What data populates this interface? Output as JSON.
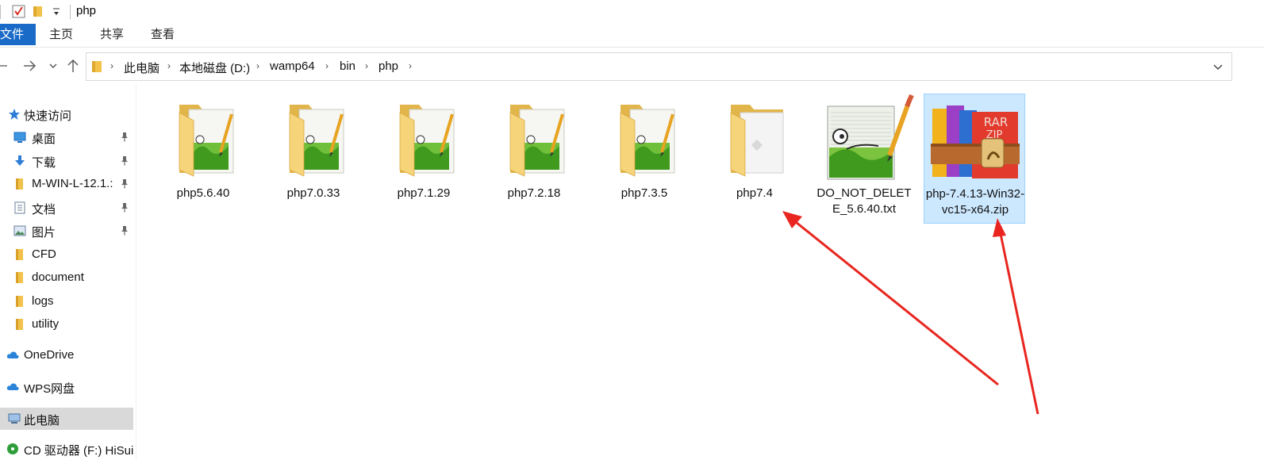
{
  "window": {
    "title": "php"
  },
  "ribbon": {
    "tabs": [
      "文件",
      "主页",
      "共享",
      "查看"
    ]
  },
  "address": {
    "crumbs": [
      "此电脑",
      "本地磁盘 (D:)",
      "wamp64",
      "bin",
      "php"
    ]
  },
  "sidebar": {
    "items": [
      {
        "label": "快速访问",
        "icon": "star-icon",
        "pinned": false
      },
      {
        "label": "桌面",
        "icon": "desktop-icon",
        "pinned": true
      },
      {
        "label": "下载",
        "icon": "download-icon",
        "pinned": true
      },
      {
        "label": "M-WIN-L-12.1.:",
        "icon": "folder-icon",
        "pinned": true
      },
      {
        "label": "文档",
        "icon": "document-icon",
        "pinned": true
      },
      {
        "label": "图片",
        "icon": "pictures-icon",
        "pinned": true
      },
      {
        "label": "CFD",
        "icon": "folder-icon",
        "pinned": false
      },
      {
        "label": "document",
        "icon": "folder-icon",
        "pinned": false
      },
      {
        "label": "logs",
        "icon": "folder-icon",
        "pinned": false
      },
      {
        "label": "utility",
        "icon": "folder-icon",
        "pinned": false
      },
      {
        "label": "OneDrive",
        "icon": "cloud-icon",
        "pinned": false
      },
      {
        "label": "WPS网盘",
        "icon": "cloud-icon",
        "pinned": false
      },
      {
        "label": "此电脑",
        "icon": "computer-icon",
        "pinned": false,
        "selected": true
      },
      {
        "label": "CD 驱动器 (F:) HiSui",
        "icon": "cd-drive-icon",
        "pinned": false
      }
    ]
  },
  "files": [
    {
      "name": "php5.6.40",
      "type": "folder-notepad"
    },
    {
      "name": "php7.0.33",
      "type": "folder-notepad"
    },
    {
      "name": "php7.1.29",
      "type": "folder-notepad"
    },
    {
      "name": "php7.2.18",
      "type": "folder-notepad"
    },
    {
      "name": "php7.3.5",
      "type": "folder-notepad"
    },
    {
      "name": "php7.4",
      "type": "folder-plain"
    },
    {
      "name": "DO_NOT_DELETE_5.6.40.txt",
      "type": "notepad-file"
    },
    {
      "name": "php-7.4.13-Win32-vc15-x64.zip",
      "type": "winrar-archive",
      "selected": true
    }
  ],
  "colors": {
    "ribbon_file_tab": "#1a6bc7",
    "folder": "#f8d775",
    "annotation_arrow": "#e8261f",
    "selection": "#cce8ff"
  }
}
